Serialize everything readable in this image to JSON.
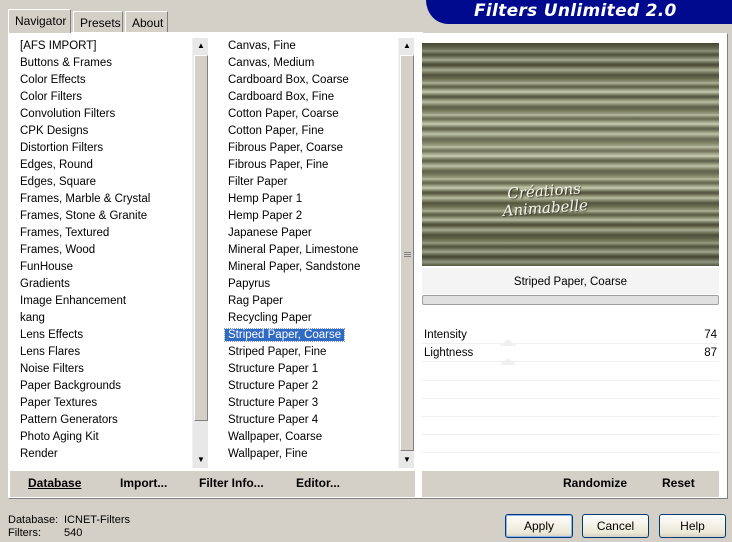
{
  "tabs": [
    "Navigator",
    "Presets",
    "About"
  ],
  "banner_title": "Filters Unlimited 2.0",
  "categories": [
    "[AFS IMPORT]",
    "Buttons & Frames",
    "Color Effects",
    "Color Filters",
    "Convolution Filters",
    "CPK Designs",
    "Distortion Filters",
    "Edges, Round",
    "Edges, Square",
    "Frames, Marble & Crystal",
    "Frames, Stone & Granite",
    "Frames, Textured",
    "Frames, Wood",
    "FunHouse",
    "Gradients",
    "Image Enhancement",
    "kang",
    "Lens Effects",
    "Lens Flares",
    "Noise Filters",
    "Paper Backgrounds",
    "Paper Textures",
    "Pattern Generators",
    "Photo Aging Kit",
    "Render"
  ],
  "filters": [
    "Canvas, Fine",
    "Canvas, Medium",
    "Cardboard Box, Coarse",
    "Cardboard Box, Fine",
    "Cotton Paper, Coarse",
    "Cotton Paper, Fine",
    "Fibrous Paper, Coarse",
    "Fibrous Paper, Fine",
    "Filter Paper",
    "Hemp Paper 1",
    "Hemp Paper 2",
    "Japanese Paper",
    "Mineral Paper, Limestone",
    "Mineral Paper, Sandstone",
    "Papyrus",
    "Rag Paper",
    "Recycling Paper",
    "Striped Paper, Coarse",
    "Striped Paper, Fine",
    "Structure Paper 1",
    "Structure Paper 2",
    "Structure Paper 3",
    "Structure Paper 4",
    "Wallpaper, Coarse",
    "Wallpaper, Fine"
  ],
  "selected_filter_index": 17,
  "preview_watermark": [
    "Créations",
    "Animabelle"
  ],
  "filter_name": "Striped Paper, Coarse",
  "params": [
    {
      "label": "Intensity",
      "value": "74"
    },
    {
      "label": "Lightness",
      "value": "87"
    }
  ],
  "toolbar": {
    "database": "Database",
    "import": "Import...",
    "filter_info": "Filter Info...",
    "editor": "Editor...",
    "randomize": "Randomize",
    "reset": "Reset"
  },
  "status": {
    "database_label": "Database:",
    "database_value": "ICNET-Filters",
    "filters_label": "Filters:",
    "filters_value": "540"
  },
  "buttons": {
    "apply": "Apply",
    "cancel": "Cancel",
    "help": "Help"
  },
  "colors": {
    "banner": "#000a8f",
    "selection": "#316ac5"
  }
}
